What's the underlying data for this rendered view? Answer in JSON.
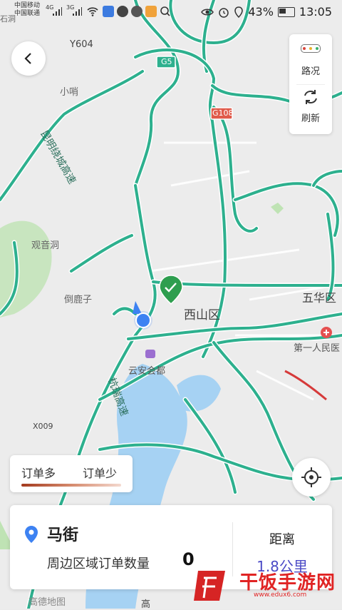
{
  "status_bar": {
    "carrier_1": "中国移动",
    "carrier_2": "中国联通",
    "net_1": "4G",
    "net_2": "3G",
    "battery": "43%",
    "time": "13:05"
  },
  "controls": {
    "traffic_label": "路况",
    "refresh_label": "刷新"
  },
  "legend": {
    "more": "订单多",
    "less": "订单少"
  },
  "map": {
    "labels": {
      "y604": "Y604",
      "g5": "G5",
      "g108": "G108",
      "xiaoshao": "小哨",
      "kunming_expressway": "昆明绕城高速",
      "guanyindong": "观音洞",
      "daoluzi": "倒鹿子",
      "xishan": "西山区",
      "wuhua": "五华区",
      "hospital": "第一人民医",
      "yunan_huidu": "云安会都",
      "hangrui": "杭瑞高速",
      "x009": "X009",
      "gao": "高",
      "shidong": "石洞"
    },
    "attribution": "高德地图"
  },
  "card": {
    "location_name": "马街",
    "order_count_label": "周边区域订单数量",
    "order_count": "0",
    "distance_label": "距离",
    "distance": "1.8公里"
  },
  "watermark": {
    "text": "干饭手游网",
    "url": "www.edux6.com"
  },
  "colors": {
    "road": "#2db08e",
    "road_outline": "#ffffff",
    "water": "#a6d2f3",
    "green": "#bfe3b4",
    "marker": "#2e9e4f",
    "user_dot": "#3d82f2",
    "distance": "#4b4ac6"
  }
}
